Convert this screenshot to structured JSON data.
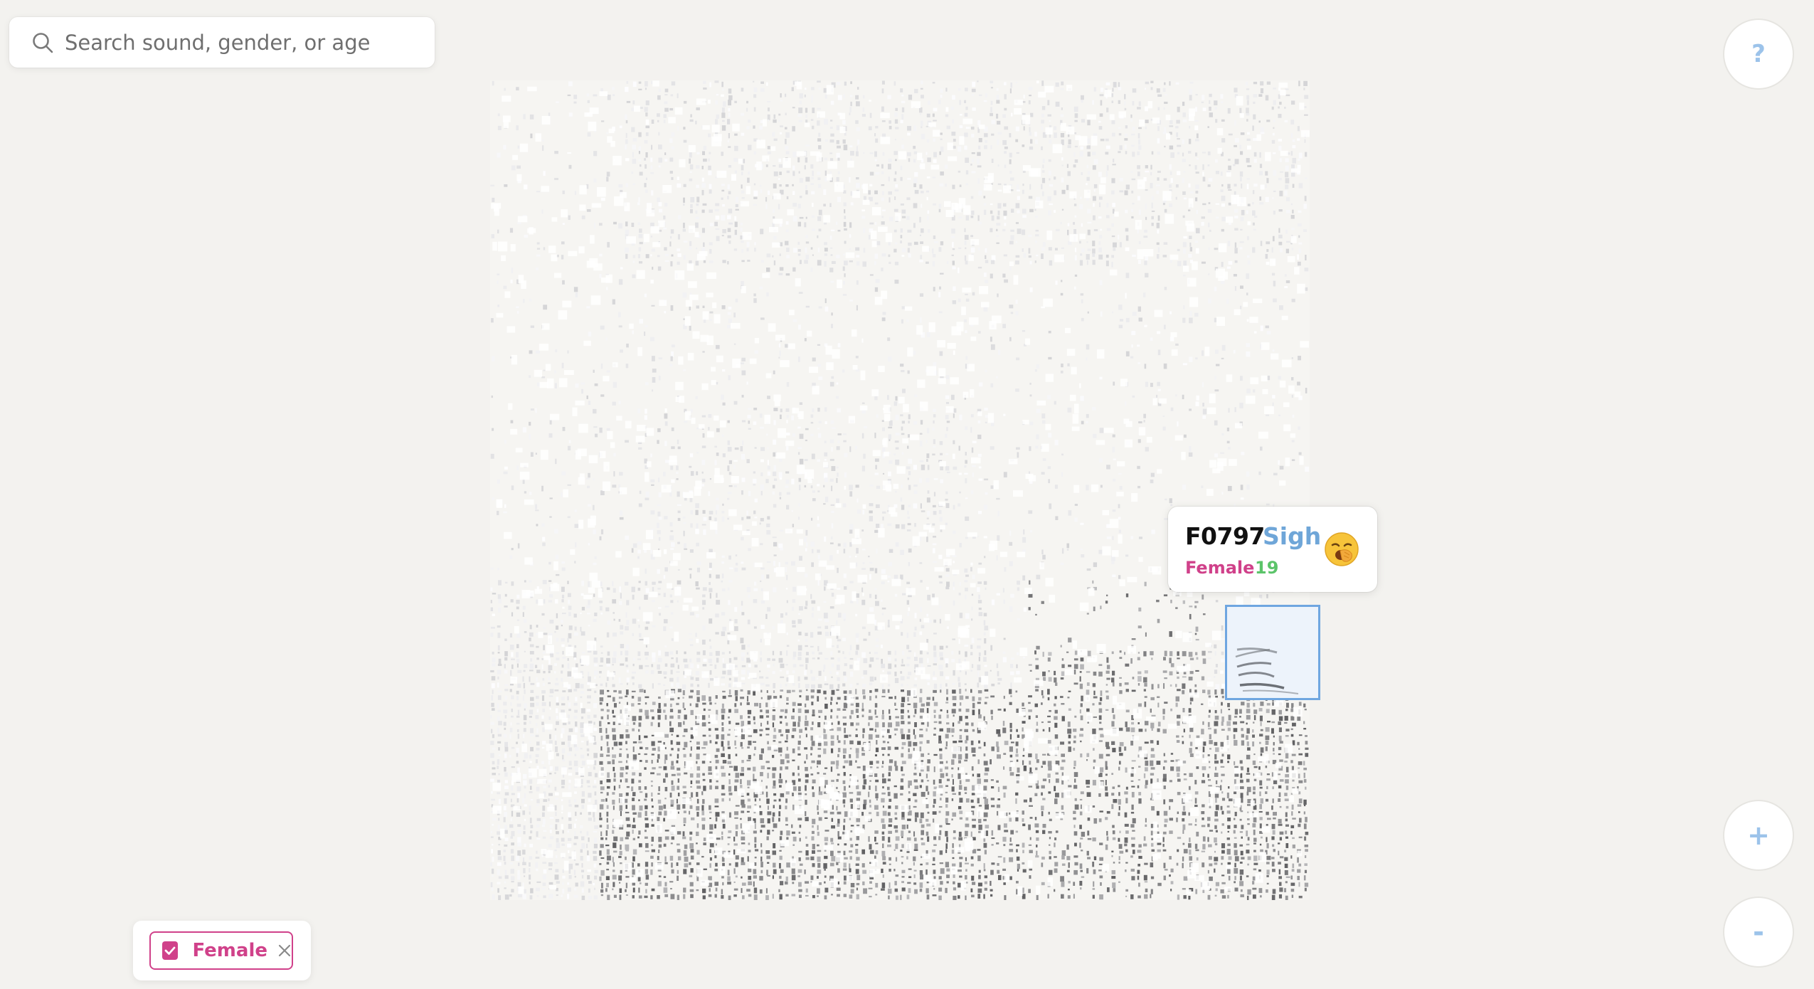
{
  "search": {
    "placeholder": "Search sound, gender, or age",
    "value": ""
  },
  "controls": {
    "help_label": "?",
    "zoom_in_label": "+",
    "zoom_out_label": "-"
  },
  "tooltip": {
    "id": "F0797",
    "sound": "Sigh",
    "gender": "Female",
    "age": "19",
    "emoji_icon": "yawning-face-icon"
  },
  "filters": [
    {
      "label": "Female",
      "checked": true
    }
  ],
  "colors": {
    "background": "#f3f2ef",
    "accent_blue": "#9cc3ea",
    "sound_blue": "#6fa6d8",
    "female_pink": "#d0418a",
    "age_green": "#5cc46a"
  }
}
